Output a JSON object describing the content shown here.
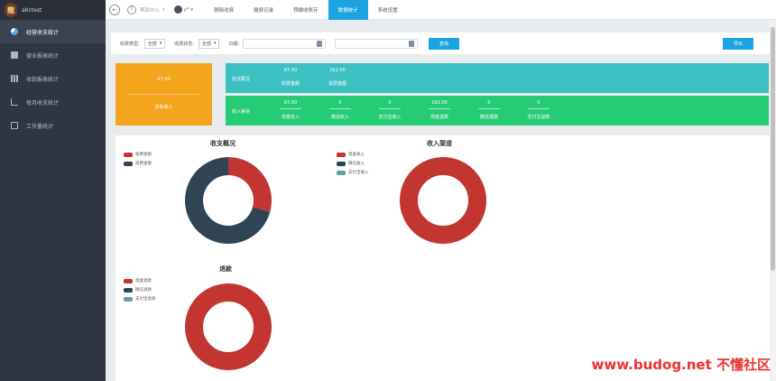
{
  "app": {
    "brand": "abctest"
  },
  "sidebar": {
    "items": [
      {
        "label": "经营收支统计",
        "icon": "pie-icon",
        "active": true
      },
      {
        "label": "营业报表统计",
        "icon": "bag-icon",
        "active": false
      },
      {
        "label": "收款报表统计",
        "icon": "bar-chart-icon",
        "active": false
      },
      {
        "label": "每月收支统计",
        "icon": "line-chart-icon",
        "active": false
      },
      {
        "label": "工作量统计",
        "icon": "calculator-icon",
        "active": false
      }
    ]
  },
  "topbar": {
    "help": "帮助中心",
    "user": "y*",
    "tabs": [
      {
        "label": "删除收费",
        "active": false
      },
      {
        "label": "缴费记录",
        "active": false
      },
      {
        "label": "预缴收账存",
        "active": false
      },
      {
        "label": "数据统计",
        "active": true
      },
      {
        "label": "系统设置",
        "active": false
      }
    ]
  },
  "filter": {
    "fee_type_label": "收费类型:",
    "fee_type_value": "全部",
    "fee_status_label": "收费状态:",
    "fee_status_value": "全部",
    "date_label": "日期:",
    "query": "查询",
    "export": "导出"
  },
  "summary": {
    "orange": {
      "value": "67.00",
      "label": "实际收入"
    },
    "teal": {
      "title": "收支概况",
      "stats": [
        {
          "value": "67.00",
          "label": "收费金额"
        },
        {
          "value": "162.00",
          "label": "退费金额"
        }
      ]
    },
    "green": {
      "title": "收入渠道",
      "stats": [
        {
          "value": "67.00",
          "label": "现金收入"
        },
        {
          "value": "0",
          "label": "微信收入"
        },
        {
          "value": "0",
          "label": "支付宝收入"
        },
        {
          "value": "162.00",
          "label": "现金退款"
        },
        {
          "value": "0",
          "label": "微信退款"
        },
        {
          "value": "0",
          "label": "支付宝退款"
        }
      ]
    }
  },
  "charts": {
    "overview": {
      "title": "收支概况",
      "legend": [
        "收费金额",
        "退费金额"
      ]
    },
    "channel": {
      "title": "收入渠道",
      "legend": [
        "现金收入",
        "微信收入",
        "支付宝收入"
      ]
    },
    "refund": {
      "title": "退款",
      "legend": [
        "现金退款",
        "微信退款",
        "支付宝退款"
      ]
    }
  },
  "chart_data": [
    {
      "type": "pie",
      "title": "收支概况",
      "categories": [
        "收费金额",
        "退费金额"
      ],
      "values": [
        67,
        162
      ],
      "colors": [
        "#c23531",
        "#2f4554"
      ],
      "donut": true
    },
    {
      "type": "pie",
      "title": "收入渠道",
      "categories": [
        "现金收入",
        "微信收入",
        "支付宝收入"
      ],
      "values": [
        67,
        0,
        0
      ],
      "colors": [
        "#c23531",
        "#2f4554",
        "#61a0a8"
      ],
      "donut": true
    },
    {
      "type": "pie",
      "title": "退款",
      "categories": [
        "现金退款",
        "微信退款",
        "支付宝退款"
      ],
      "values": [
        162,
        0,
        0
      ],
      "colors": [
        "#c23531",
        "#2f4554",
        "#61a0a8"
      ],
      "donut": true
    }
  ],
  "watermark": "www.budog.net 不懂社区"
}
